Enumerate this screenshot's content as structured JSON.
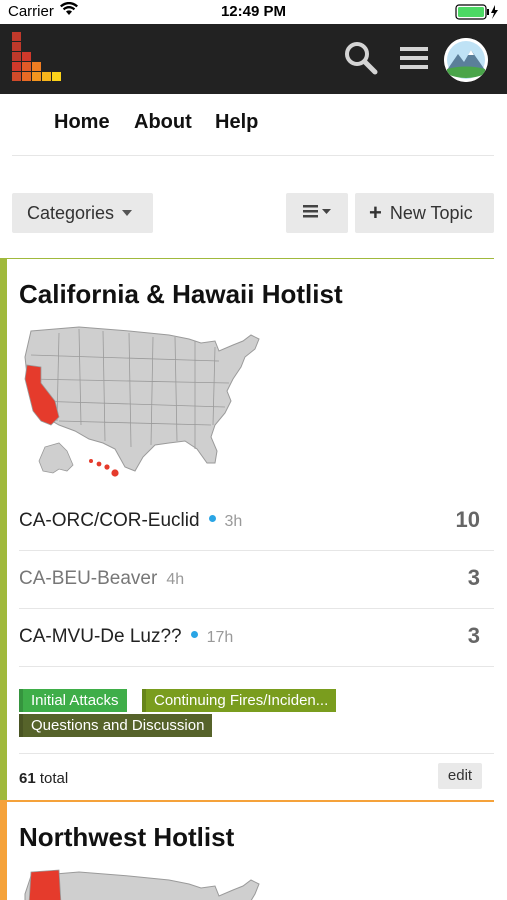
{
  "status_bar": {
    "carrier": "Carrier",
    "time": "12:49 PM"
  },
  "nav": {
    "home": "Home",
    "about": "About",
    "help": "Help"
  },
  "toolbar": {
    "categories_label": "Categories",
    "new_topic_label": "New Topic"
  },
  "categories": [
    {
      "title": "California & Hawaii Hotlist",
      "color": "#a0b93c",
      "topics": [
        {
          "title": "CA-ORC/COR-Euclid",
          "age": "3h",
          "count": "10"
        },
        {
          "title": "CA-BEU-Beaver",
          "age": "4h",
          "count": "3"
        },
        {
          "title": "CA-MVU-De Luz??",
          "age": "17h",
          "count": "3"
        }
      ],
      "tags": [
        "Initial Attacks",
        "Continuing Fires/Inciden...",
        "Questions and Discussion"
      ],
      "total_count": "61",
      "total_label": "total",
      "edit_label": "edit"
    },
    {
      "title": "Northwest Hotlist",
      "color": "#f5a23a"
    }
  ]
}
